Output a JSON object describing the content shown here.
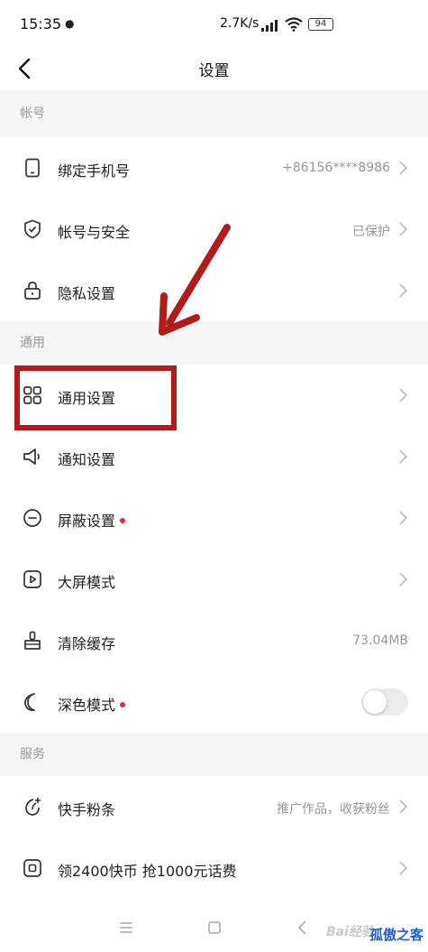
{
  "status_bar": {
    "time": "15:35",
    "network_speed": "2.7K/s",
    "battery": "94"
  },
  "nav": {
    "title": "设置"
  },
  "sections": {
    "account": {
      "header": "帐号",
      "items": [
        {
          "label": "绑定手机号",
          "value": "+86156****8986",
          "icon": "phone-icon"
        },
        {
          "label": "帐号与安全",
          "value": "已保护",
          "icon": "shield-check-icon"
        },
        {
          "label": "隐私设置",
          "value": "",
          "icon": "lock-icon"
        }
      ]
    },
    "general": {
      "header": "通用",
      "items": [
        {
          "label": "通用设置",
          "icon": "grid-icon"
        },
        {
          "label": "通知设置",
          "icon": "speaker-icon"
        },
        {
          "label": "屏蔽设置",
          "icon": "block-icon",
          "red_dot": true
        },
        {
          "label": "大屏模式",
          "icon": "play-screen-icon"
        },
        {
          "label": "清除缓存",
          "value": "73.04MB",
          "icon": "broom-icon"
        },
        {
          "label": "深色模式",
          "icon": "moon-icon",
          "red_dot": true,
          "toggle": "off"
        }
      ]
    },
    "service": {
      "header": "服务",
      "items": [
        {
          "label": "快手粉条",
          "value": "推广作品，收获粉丝",
          "icon": "sprout-icon"
        },
        {
          "label": "领2400快币 抢1000元话费",
          "icon": "coin-card-icon"
        }
      ]
    }
  },
  "watermark": {
    "text": "孤傲之客",
    "baidu": "Bai经验"
  },
  "colors": {
    "accent_red": "#e52a3b",
    "annotation_red": "#b31b1b",
    "section_bg": "#f5f5f5"
  }
}
